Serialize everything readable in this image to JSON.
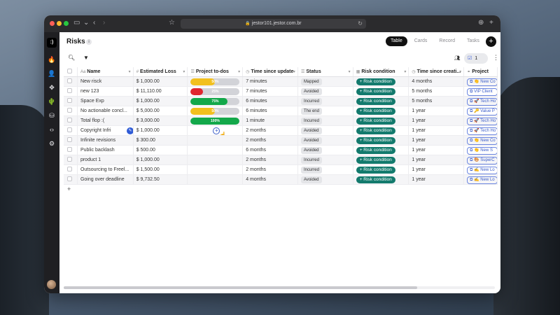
{
  "browser": {
    "url": "jestor101.jestor.com.br"
  },
  "sidebar": {
    "logo_text": ":)",
    "icons": [
      "fire-icon",
      "user-plus-icon",
      "move-icon",
      "cactus-icon",
      "database-icon",
      "code-icon",
      "gear-icon"
    ]
  },
  "header": {
    "title": "Risks",
    "info": "i",
    "views": [
      {
        "label": "Table",
        "active": true
      },
      {
        "label": "Cards",
        "active": false
      },
      {
        "label": "Record",
        "active": false
      },
      {
        "label": "Tasks",
        "active": false
      }
    ],
    "add_label": "+"
  },
  "toolbar": {
    "filter_count": "1"
  },
  "columns": [
    "Name",
    "Estimated Loss",
    "Project to-dos",
    "Time since update",
    "Status",
    "Risk condition",
    "Time since creati...",
    "Project"
  ],
  "rows": [
    {
      "name": "New risck",
      "loss": "$ 1,000.00",
      "todo": "50%",
      "todo_pct": 50,
      "todo_color": "#f2c01e",
      "updated": "7 minutes",
      "status": "Mapped",
      "risk": "+ Risk condition",
      "created": "4 months",
      "project": "👏 New Co"
    },
    {
      "name": "new 123",
      "loss": "$ 11,110.00",
      "todo": "25%",
      "todo_pct": 25,
      "todo_color": "#e0262e",
      "updated": "7 minutes",
      "status": "Avoided",
      "risk": "+ Risk condition",
      "created": "5 months",
      "project": "VIP Client"
    },
    {
      "name": "Space Exp",
      "loss": "$ 1,000.00",
      "todo": "75%",
      "todo_pct": 75,
      "todo_color": "#13a84a",
      "updated": "6 minutes",
      "status": "Incurred",
      "risk": "+ Risk condition",
      "created": "5 months",
      "project": "🚀 Tech Ho"
    },
    {
      "name": "No actionable concl...",
      "loss": "$ 5,000.00",
      "todo": "50%",
      "todo_pct": 50,
      "todo_color": "#f2c01e",
      "updated": "6 minutes",
      "status": "The end",
      "risk": "+ Risk condition",
      "created": "1 year",
      "project": "🔑 Value P"
    },
    {
      "name": "Total flop :(",
      "loss": "$ 3,000.00",
      "todo": "100%",
      "todo_pct": 100,
      "todo_color": "#13a84a",
      "updated": "1 minute",
      "status": "Incurred",
      "risk": "+ Risk condition",
      "created": "1 year",
      "project": "🚀 Tech Ho"
    },
    {
      "name": "Copyright Infri",
      "loss": "$ 1,000.00",
      "todo": "",
      "todo_pct": null,
      "todo_color": "",
      "updated": "2 months",
      "status": "Avoided",
      "risk": "+ Risk condition",
      "created": "1 year",
      "project": "🚀 Tech Ho",
      "hovered": true
    },
    {
      "name": "Infinite revisions",
      "loss": "$ 300.00",
      "todo": "",
      "todo_pct": null,
      "todo_color": "",
      "updated": "2 months",
      "status": "Avoided",
      "risk": "+ Risk condition",
      "created": "1 year",
      "project": "👏 New Co"
    },
    {
      "name": "Public backlash",
      "loss": "$ 500.00",
      "todo": "",
      "todo_pct": null,
      "todo_color": "",
      "updated": "6 months",
      "status": "Avoided",
      "risk": "+ Risk condition",
      "created": "1 year",
      "project": "👏 New S"
    },
    {
      "name": "product 1",
      "loss": "$ 1,000.00",
      "todo": "",
      "todo_pct": null,
      "todo_color": "",
      "updated": "2 months",
      "status": "Incurred",
      "risk": "+ Risk condition",
      "created": "1 year",
      "project": "🎨 SuperC"
    },
    {
      "name": "Outsourcing to Freel...",
      "loss": "$ 1,500.00",
      "todo": "",
      "todo_pct": null,
      "todo_color": "",
      "updated": "2 months",
      "status": "Incurred",
      "risk": "+ Risk condition",
      "created": "1 year",
      "project": "✍️ New Lo"
    },
    {
      "name": "Going over deadline",
      "loss": "$ 9,732.50",
      "todo": "",
      "todo_pct": null,
      "todo_color": "",
      "updated": "4 months",
      "status": "Avoided",
      "risk": "+ Risk condition",
      "created": "1 year",
      "project": "✍️ New Lo"
    }
  ],
  "add_row_label": "+"
}
